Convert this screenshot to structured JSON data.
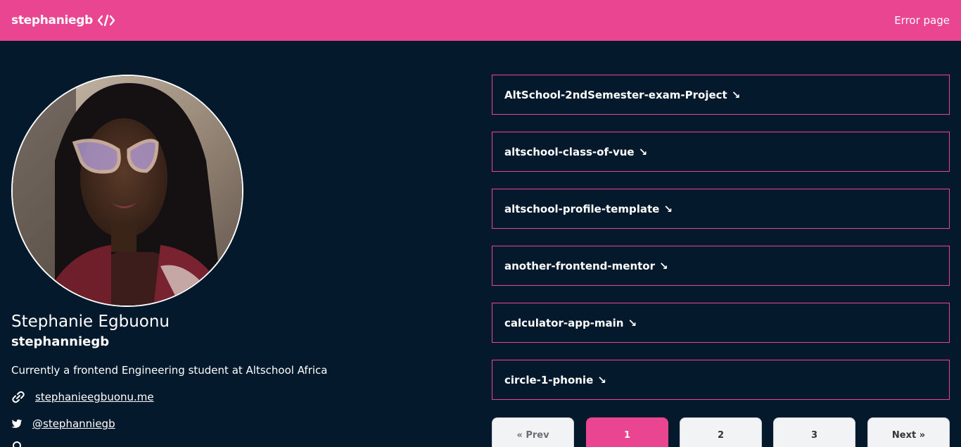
{
  "header": {
    "brand": "stephaniegb",
    "brand_icon": "code-icon",
    "nav_link": "Error page",
    "accent": "#ea4591",
    "background": "#04192c"
  },
  "profile": {
    "avatar": "profile-photo",
    "name": "Stephanie Egbuonu",
    "username": "stephanniegb",
    "bio": "Currently a frontend Engineering student at Altschool Africa",
    "website": "stephanieegbuonu.me",
    "twitter": "@stephanniegb"
  },
  "repos": [
    {
      "name": "AltSchool-2ndSemester-exam-Project",
      "arrow": "↘"
    },
    {
      "name": "altschool-class-of-vue",
      "arrow": "↘"
    },
    {
      "name": "altschool-profile-template",
      "arrow": "↘"
    },
    {
      "name": "another-frontend-mentor",
      "arrow": "↘"
    },
    {
      "name": "calculator-app-main",
      "arrow": "↘"
    },
    {
      "name": "circle-1-phonie",
      "arrow": "↘"
    }
  ],
  "pagination": {
    "prev": "« Prev",
    "pages": [
      "1",
      "2",
      "3"
    ],
    "current": "1",
    "next": "Next »"
  }
}
